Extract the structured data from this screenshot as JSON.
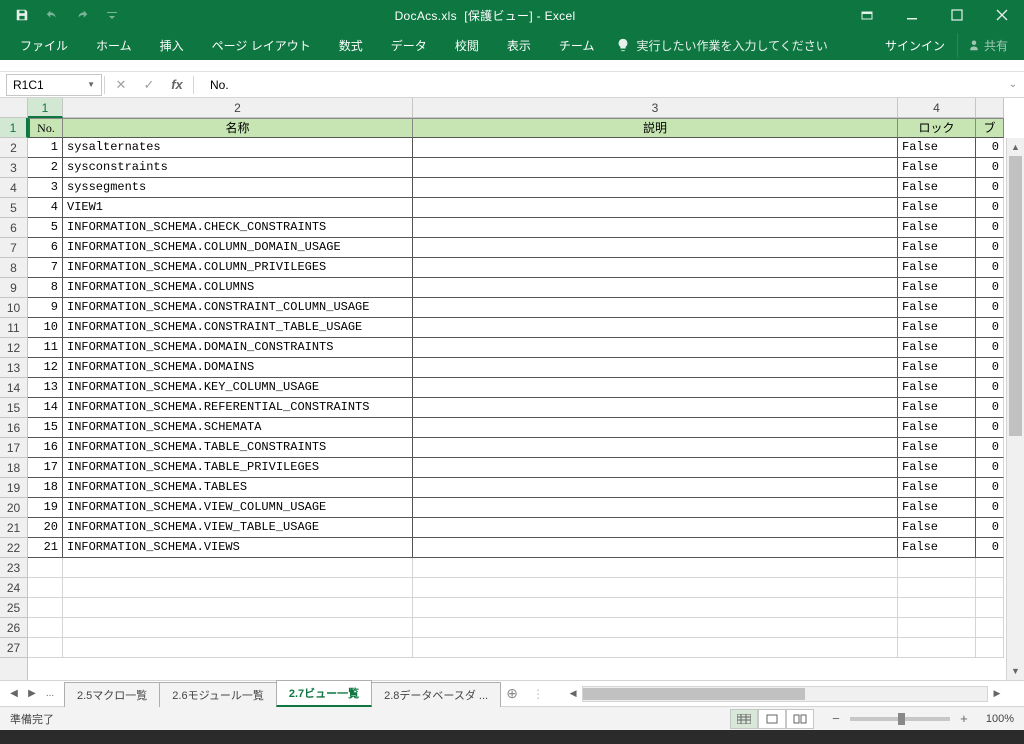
{
  "titlebar": {
    "filename": "DocAcs.xls",
    "mode": "[保護ビュー]",
    "app": "Excel"
  },
  "ribbon": {
    "tabs": [
      "ファイル",
      "ホーム",
      "挿入",
      "ページ レイアウト",
      "数式",
      "データ",
      "校閲",
      "表示",
      "チーム"
    ],
    "tellme": "実行したい作業を入力してください",
    "signin": "サインイン",
    "share": "共有"
  },
  "formula_bar": {
    "name_box": "R1C1",
    "formula": "No."
  },
  "columns": {
    "labels": [
      "1",
      "2",
      "3",
      "4"
    ],
    "partial": "ブ",
    "widths": [
      35,
      350,
      485,
      78,
      28
    ]
  },
  "headers": [
    "No.",
    "名称",
    "説明",
    "ロック"
  ],
  "rows": [
    {
      "no": "1",
      "name": "sysalternates",
      "desc": "",
      "lock": "False",
      "p": "0"
    },
    {
      "no": "2",
      "name": "sysconstraints",
      "desc": "",
      "lock": "False",
      "p": "0"
    },
    {
      "no": "3",
      "name": "syssegments",
      "desc": "",
      "lock": "False",
      "p": "0"
    },
    {
      "no": "4",
      "name": "VIEW1",
      "desc": "",
      "lock": "False",
      "p": "0"
    },
    {
      "no": "5",
      "name": "INFORMATION_SCHEMA.CHECK_CONSTRAINTS",
      "desc": "",
      "lock": "False",
      "p": "0"
    },
    {
      "no": "6",
      "name": "INFORMATION_SCHEMA.COLUMN_DOMAIN_USAGE",
      "desc": "",
      "lock": "False",
      "p": "0"
    },
    {
      "no": "7",
      "name": "INFORMATION_SCHEMA.COLUMN_PRIVILEGES",
      "desc": "",
      "lock": "False",
      "p": "0"
    },
    {
      "no": "8",
      "name": "INFORMATION_SCHEMA.COLUMNS",
      "desc": "",
      "lock": "False",
      "p": "0"
    },
    {
      "no": "9",
      "name": "INFORMATION_SCHEMA.CONSTRAINT_COLUMN_USAGE",
      "desc": "",
      "lock": "False",
      "p": "0"
    },
    {
      "no": "10",
      "name": "INFORMATION_SCHEMA.CONSTRAINT_TABLE_USAGE",
      "desc": "",
      "lock": "False",
      "p": "0"
    },
    {
      "no": "11",
      "name": "INFORMATION_SCHEMA.DOMAIN_CONSTRAINTS",
      "desc": "",
      "lock": "False",
      "p": "0"
    },
    {
      "no": "12",
      "name": "INFORMATION_SCHEMA.DOMAINS",
      "desc": "",
      "lock": "False",
      "p": "0"
    },
    {
      "no": "13",
      "name": "INFORMATION_SCHEMA.KEY_COLUMN_USAGE",
      "desc": "",
      "lock": "False",
      "p": "0"
    },
    {
      "no": "14",
      "name": "INFORMATION_SCHEMA.REFERENTIAL_CONSTRAINTS",
      "desc": "",
      "lock": "False",
      "p": "0"
    },
    {
      "no": "15",
      "name": "INFORMATION_SCHEMA.SCHEMATA",
      "desc": "",
      "lock": "False",
      "p": "0"
    },
    {
      "no": "16",
      "name": "INFORMATION_SCHEMA.TABLE_CONSTRAINTS",
      "desc": "",
      "lock": "False",
      "p": "0"
    },
    {
      "no": "17",
      "name": "INFORMATION_SCHEMA.TABLE_PRIVILEGES",
      "desc": "",
      "lock": "False",
      "p": "0"
    },
    {
      "no": "18",
      "name": "INFORMATION_SCHEMA.TABLES",
      "desc": "",
      "lock": "False",
      "p": "0"
    },
    {
      "no": "19",
      "name": "INFORMATION_SCHEMA.VIEW_COLUMN_USAGE",
      "desc": "",
      "lock": "False",
      "p": "0"
    },
    {
      "no": "20",
      "name": "INFORMATION_SCHEMA.VIEW_TABLE_USAGE",
      "desc": "",
      "lock": "False",
      "p": "0"
    },
    {
      "no": "21",
      "name": "INFORMATION_SCHEMA.VIEWS",
      "desc": "",
      "lock": "False",
      "p": "0"
    }
  ],
  "empty_rows": 5,
  "row_labels": [
    "1",
    "2",
    "3",
    "4",
    "5",
    "6",
    "7",
    "8",
    "9",
    "10",
    "11",
    "12",
    "13",
    "14",
    "15",
    "16",
    "17",
    "18",
    "19",
    "20",
    "21",
    "22",
    "23",
    "24",
    "25",
    "26",
    "27"
  ],
  "sheet_tabs": {
    "ellipsis": "...",
    "tabs": [
      {
        "label": "2.5マクロ一覧",
        "active": false
      },
      {
        "label": "2.6モジュール一覧",
        "active": false
      },
      {
        "label": "2.7ビュー一覧",
        "active": true
      },
      {
        "label": "2.8データベースダ ...",
        "active": false
      }
    ]
  },
  "statusbar": {
    "status": "準備完了",
    "zoom": "100%"
  }
}
